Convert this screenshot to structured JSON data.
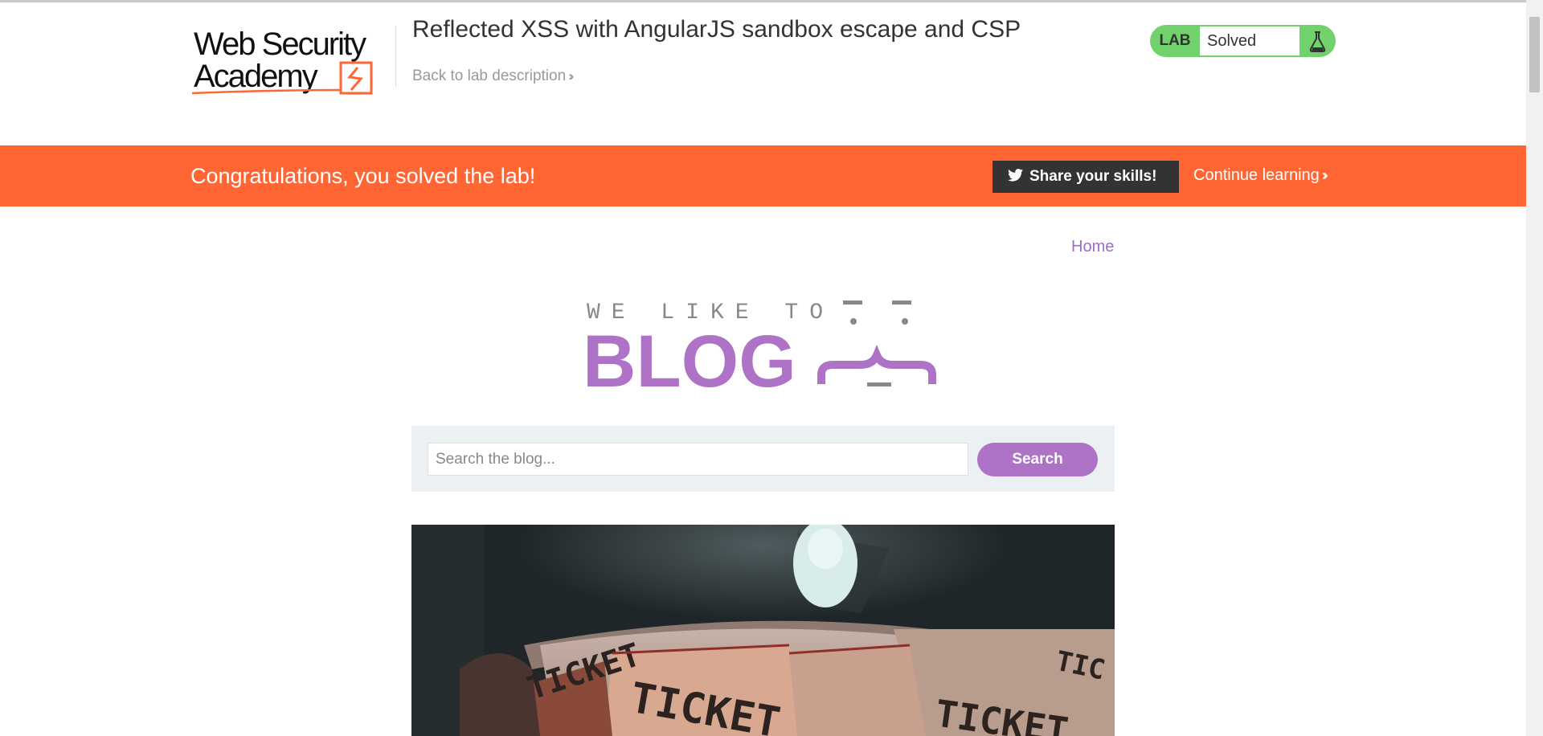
{
  "academy": {
    "logo_line1": "Web Security",
    "logo_line2": "Academy"
  },
  "lab": {
    "title": "Reflected XSS with AngularJS sandbox escape and CSP",
    "back_link": "Back to lab description",
    "status_tag": "LAB",
    "status_value": "Solved"
  },
  "banner": {
    "message": "Congratulations, you solved the lab!",
    "share_label": "Share your skills!",
    "continue_label": "Continue learning",
    "color": "#ff6633"
  },
  "blog": {
    "nav_home": "Home",
    "tagline": "WE LIKE TO",
    "name": "BLOG",
    "accent_color": "#ae73c6",
    "search": {
      "placeholder": "Search the blog...",
      "value": "",
      "button_label": "Search"
    },
    "post_image_icon": "tickets-photo"
  }
}
